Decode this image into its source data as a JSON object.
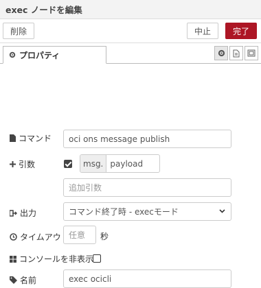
{
  "header": {
    "title": "exec ノードを編集"
  },
  "toolbar": {
    "delete_label": "削除",
    "cancel_label": "中止",
    "done_label": "完了"
  },
  "tabs": {
    "properties_label": "プロパティ"
  },
  "tab_icons": [
    "gear-icon",
    "document-icon",
    "frame-icon"
  ],
  "form": {
    "command": {
      "label": "コマンド",
      "value": "oci ons message publish"
    },
    "args": {
      "label": "引数",
      "checked": true,
      "prefix": "msg.",
      "value": "payload"
    },
    "extra_args": {
      "placeholder": "追加引数"
    },
    "output": {
      "label": "出力",
      "selected": "コマンド終了時 - execモード"
    },
    "timeout": {
      "label": "タイムアウト",
      "placeholder": "任意",
      "unit": "秒"
    },
    "hide_console": {
      "label": "コンソールを非表示",
      "checked": false
    },
    "name": {
      "label": "名前",
      "value": "exec ocicli"
    }
  },
  "colors": {
    "accent": "#ad1625"
  }
}
